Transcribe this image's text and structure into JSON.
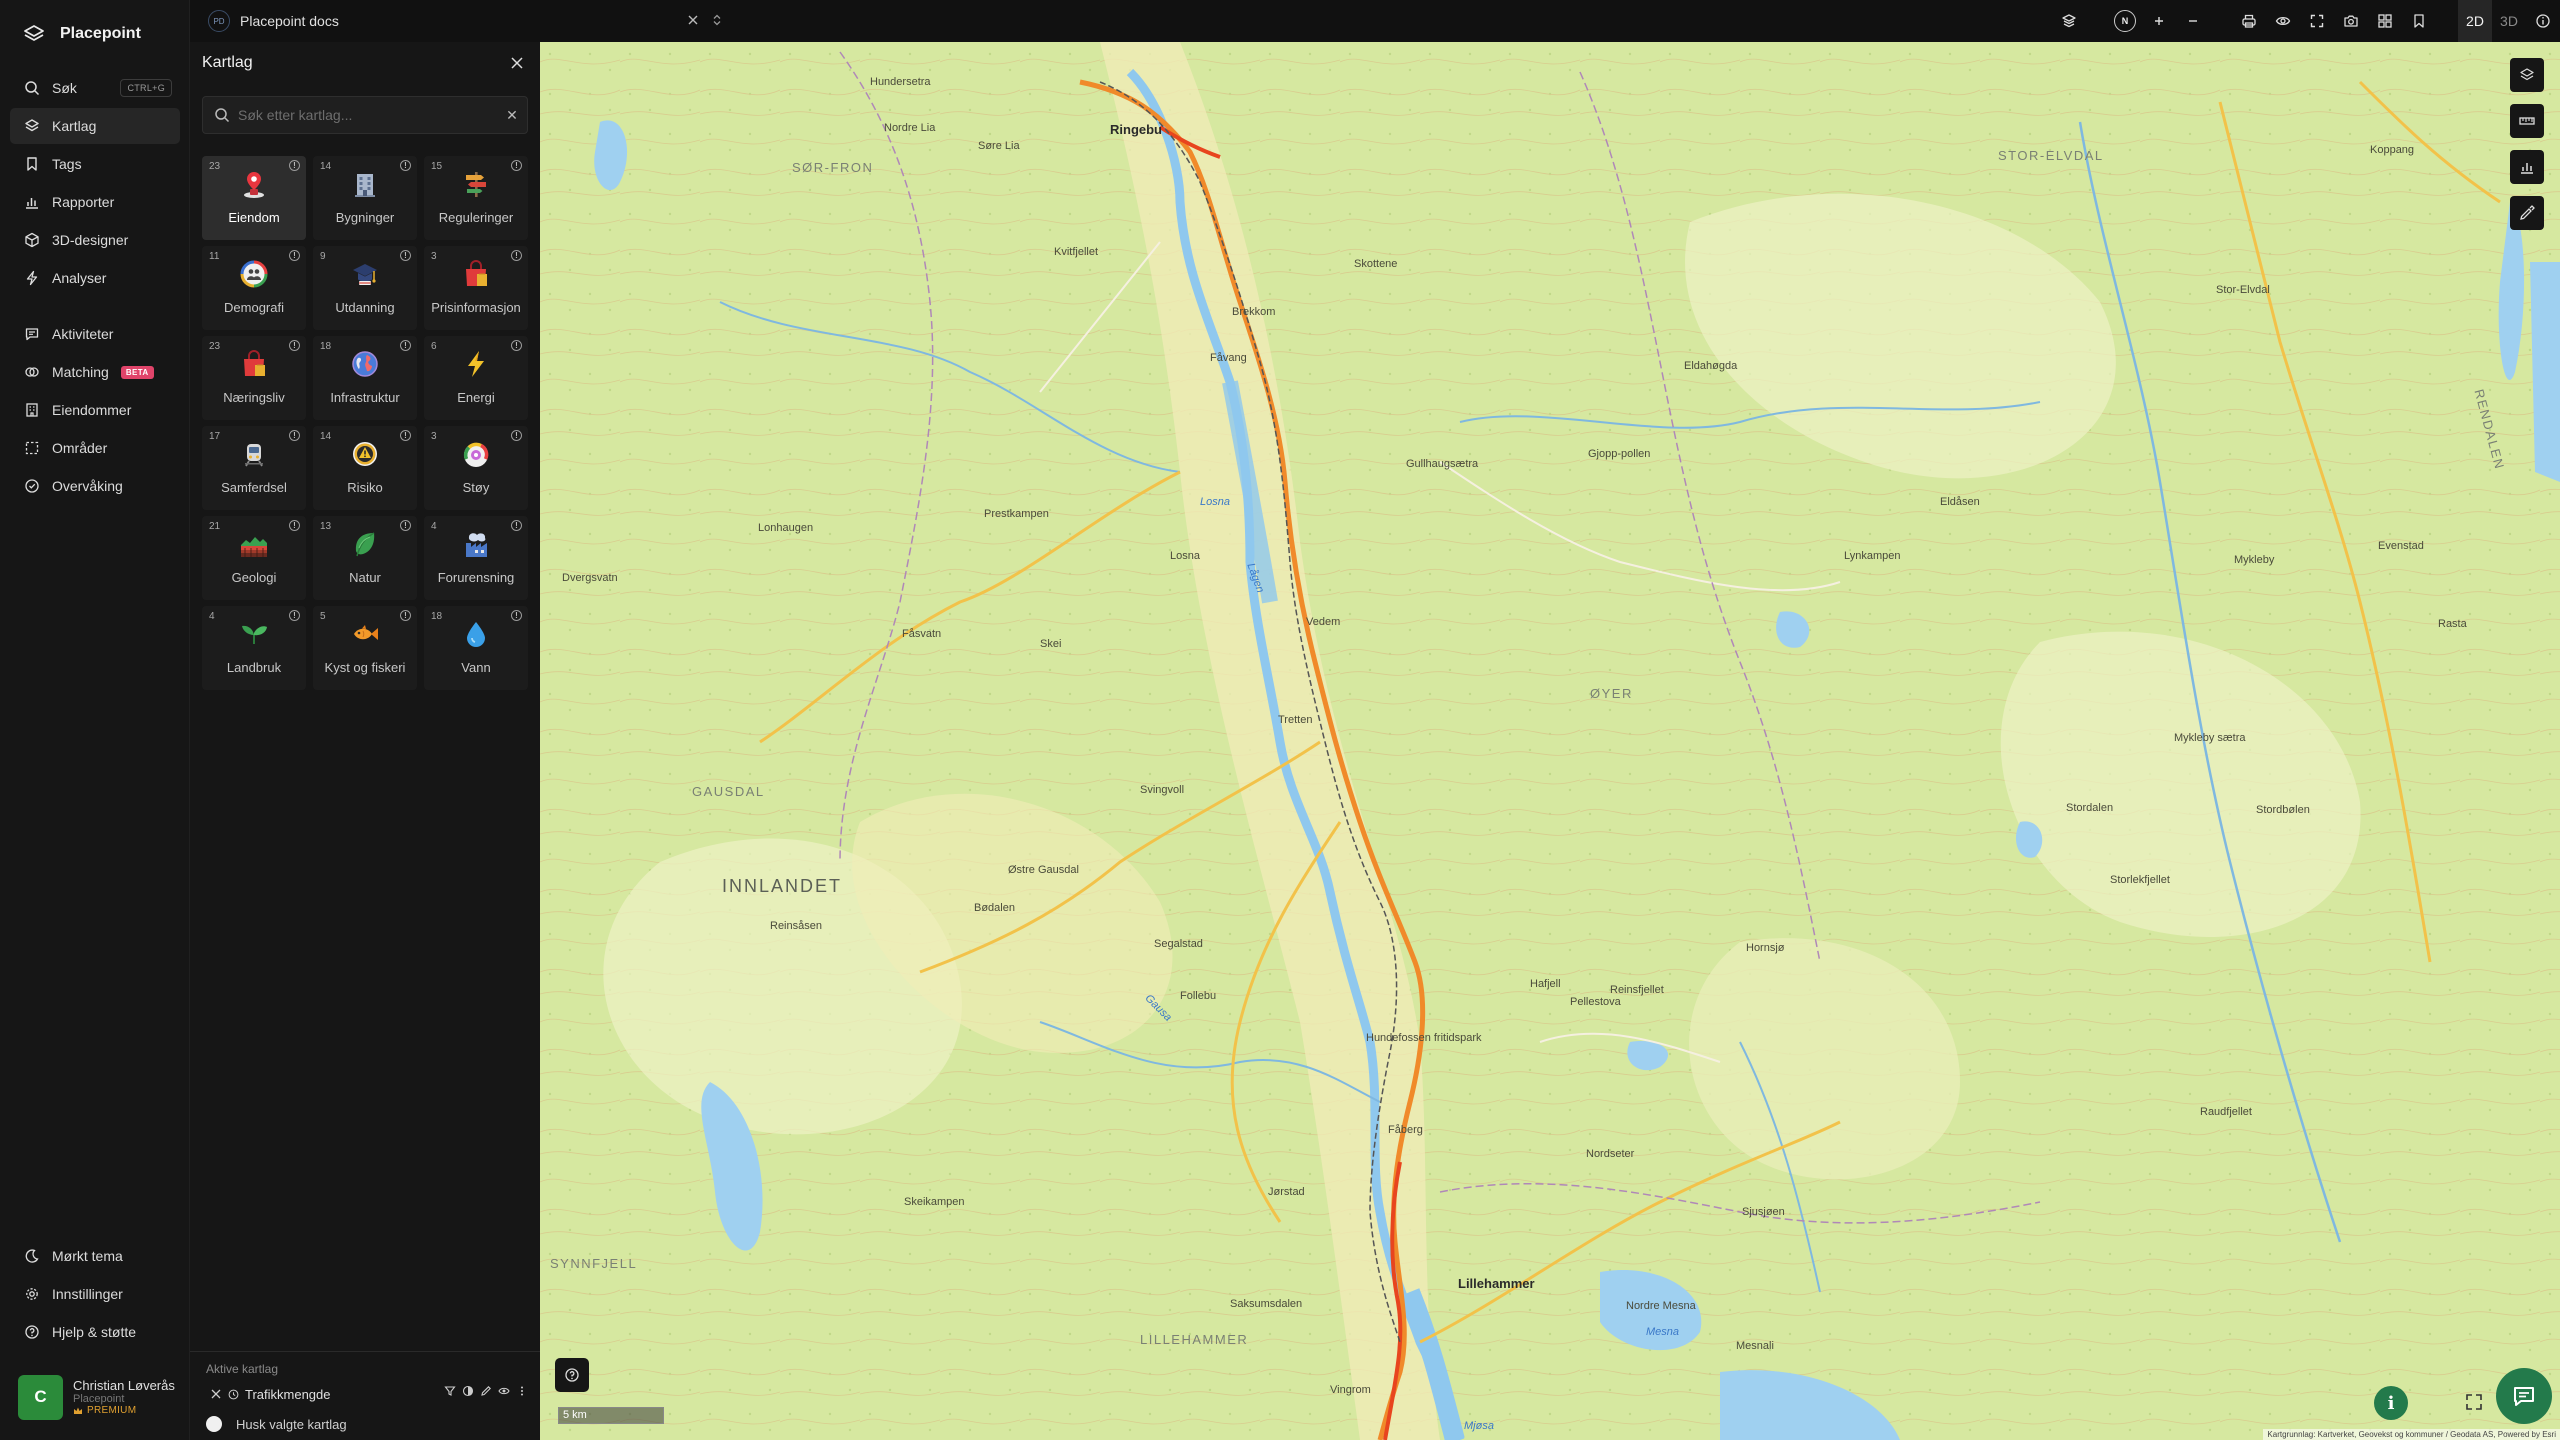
{
  "app": {
    "name": "Placepoint"
  },
  "nav": {
    "main": [
      {
        "label": "Søk",
        "shortcut": "CTRL+G",
        "icon": "search-icon"
      },
      {
        "label": "Kartlag",
        "icon": "layers-icon",
        "active": true
      },
      {
        "label": "Tags",
        "icon": "bookmark-icon"
      },
      {
        "label": "Rapporter",
        "icon": "bar-chart-icon"
      },
      {
        "label": "3D-designer",
        "icon": "cube-icon"
      },
      {
        "label": "Analyser",
        "icon": "lightning-icon"
      }
    ],
    "secondary": [
      {
        "label": "Aktiviteter",
        "icon": "chat-icon"
      },
      {
        "label": "Matching",
        "badge": "BETA",
        "icon": "match-icon"
      },
      {
        "label": "Eiendommer",
        "icon": "building-icon"
      },
      {
        "label": "Områder",
        "icon": "area-icon"
      },
      {
        "label": "Overvåking",
        "icon": "monitor-icon"
      }
    ],
    "bottom": [
      {
        "label": "Mørkt tema",
        "icon": "moon-icon"
      },
      {
        "label": "Innstillinger",
        "icon": "gear-icon"
      },
      {
        "label": "Hjelp & støtte",
        "icon": "help-icon"
      }
    ]
  },
  "user": {
    "initial": "C",
    "name": "Christian Løverås",
    "org": "Placepoint",
    "plan": "PREMIUM"
  },
  "topbar": {
    "docs_badge": "PD",
    "docs_title": "Placepoint docs",
    "compass_label": "N",
    "modes": [
      "2D",
      "3D"
    ],
    "active_mode": "2D"
  },
  "panel": {
    "title": "Kartlag",
    "search_placeholder": "Søk etter kartlag...",
    "categories": [
      {
        "label": "Eiendom",
        "count": "23",
        "icon": "pin-icon",
        "selected": true
      },
      {
        "label": "Bygninger",
        "count": "14",
        "icon": "building-icon"
      },
      {
        "label": "Reguleringer",
        "count": "15",
        "icon": "signpost-icon"
      },
      {
        "label": "Demografi",
        "count": "11",
        "icon": "people-icon"
      },
      {
        "label": "Utdanning",
        "count": "9",
        "icon": "graduation-cap-icon"
      },
      {
        "label": "Prisinformasjon",
        "count": "3",
        "icon": "shopping-bag-icon"
      },
      {
        "label": "Næringsliv",
        "count": "23",
        "icon": "shopping-bag-icon"
      },
      {
        "label": "Infrastruktur",
        "count": "18",
        "icon": "globe-icon"
      },
      {
        "label": "Energi",
        "count": "6",
        "icon": "lightning-icon"
      },
      {
        "label": "Samferdsel",
        "count": "17",
        "icon": "train-icon"
      },
      {
        "label": "Risiko",
        "count": "14",
        "icon": "warning-icon"
      },
      {
        "label": "Støy",
        "count": "3",
        "icon": "gauge-icon"
      },
      {
        "label": "Geologi",
        "count": "21",
        "icon": "terrain-icon"
      },
      {
        "label": "Natur",
        "count": "13",
        "icon": "leaf-icon"
      },
      {
        "label": "Forurensning",
        "count": "4",
        "icon": "factory-icon"
      },
      {
        "label": "Landbruk",
        "count": "4",
        "icon": "sprout-icon"
      },
      {
        "label": "Kyst og fiskeri",
        "count": "5",
        "icon": "fish-icon"
      },
      {
        "label": "Vann",
        "count": "18",
        "icon": "water-drop-icon"
      }
    ],
    "active_title": "Aktive kartlag",
    "active_layers": [
      {
        "label": "Trafikkmengde"
      }
    ],
    "remember_label": "Husk valgte kartlag"
  },
  "map": {
    "scale_label": "5 km",
    "attribution": "Kartgrunnlag: Kartverket, Geovekst og kommuner / Geodata AS, Powered by Esri",
    "regions": [
      "INNLANDET"
    ],
    "areas": [
      "SØR-FRON",
      "STOR-ELVDAL",
      "RENDALEN",
      "GAUSDAL",
      "ØYER",
      "LILLEHAMMER",
      "SYNNFJELL"
    ],
    "places": [
      "Ringebu",
      "Fåvang",
      "Tretten",
      "Lillehammer",
      "Fåberg",
      "Vingrom",
      "Kvitfjellet",
      "Brekkom",
      "Koppang",
      "Eldåsen",
      "Prestkampen",
      "Losna",
      "Vedem",
      "Svingvoll",
      "Bødalen",
      "Skeikampen",
      "Hafjell",
      "Pellestova",
      "Stordalen",
      "Skei",
      "Hundersetra",
      "Nordre Lia",
      "Søre Lia",
      "Skottene",
      "Eldahøgda",
      "Gjopp-pollen",
      "Gullhaugsætra",
      "Lynkampen",
      "Mykleby",
      "Evenstad",
      "Rasta",
      "Mykleby sætra",
      "Stordbølen",
      "Storlekfjellet",
      "Raudfjellet",
      "Saksumsdalen",
      "Jørstad",
      "Follebu",
      "Segalstad",
      "Østre Gausdal",
      "Reinsåsen",
      "Lonhaugen",
      "Dvergsvatn",
      "Fåsvatn",
      "Hornsjø",
      "Nordseter",
      "Sjusjøen",
      "Reinsfjellet",
      "Hundefossen fritidspark",
      "Stor-Elvdal",
      "Nordre Mesna",
      "Mesnali"
    ],
    "waters": [
      "Lågen",
      "Losna",
      "Gausa",
      "Mesna",
      "Mjøsa"
    ]
  }
}
